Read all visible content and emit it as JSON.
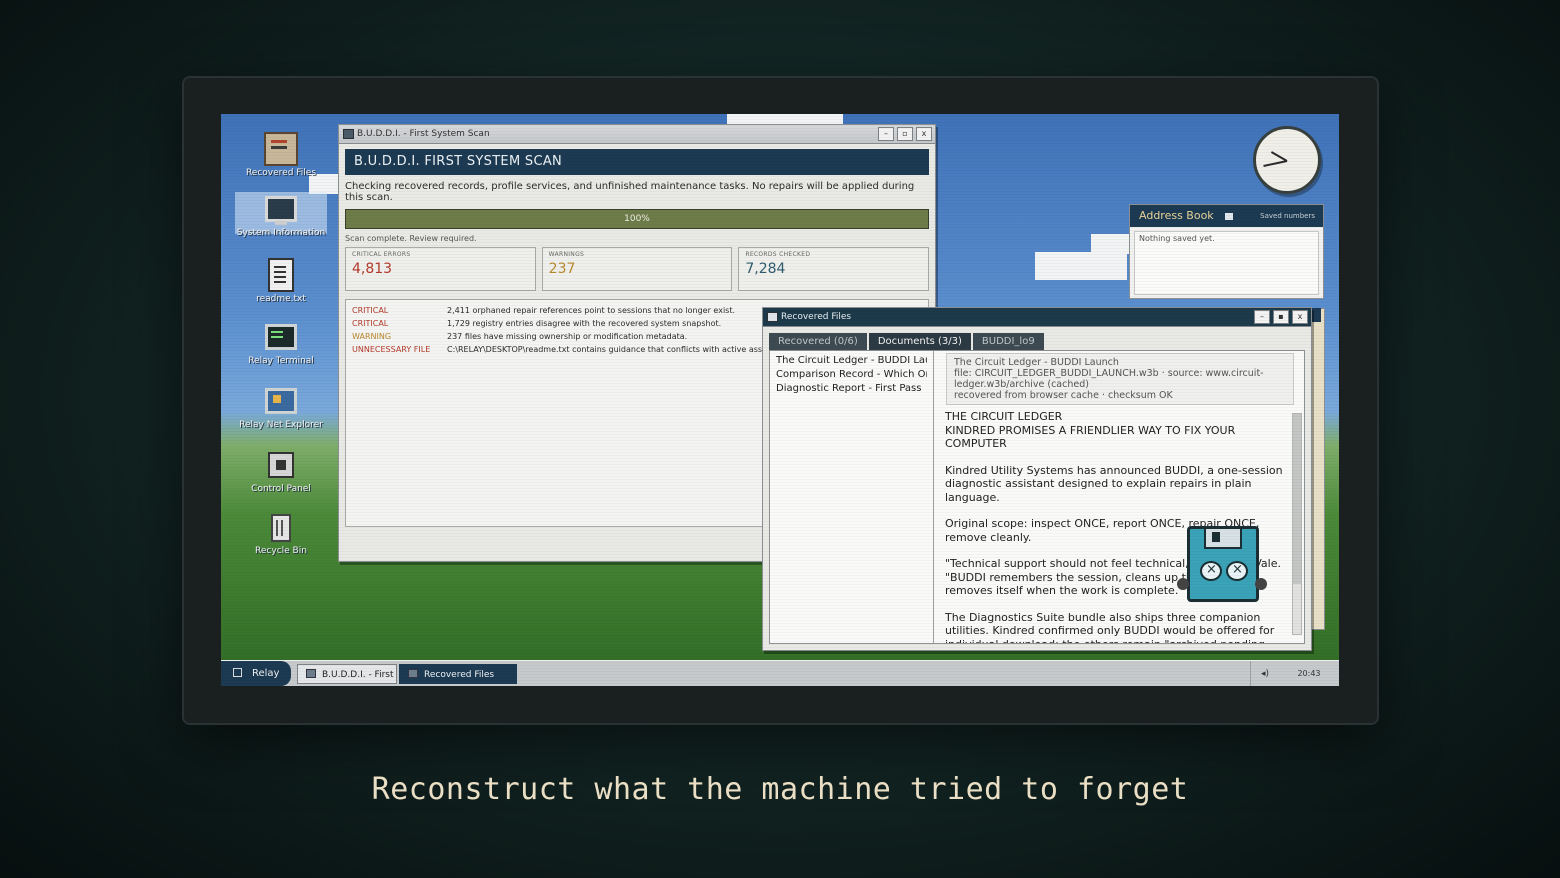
{
  "desktop_icons": [
    {
      "label": "Recovered Files",
      "icon": "recovered-files-icon"
    },
    {
      "label": "System Information",
      "icon": "system-information-icon"
    },
    {
      "label": "readme.txt",
      "icon": "readme-icon"
    },
    {
      "label": "Relay Terminal",
      "icon": "terminal-icon"
    },
    {
      "label": "Relay Net Explorer",
      "icon": "net-explorer-icon"
    },
    {
      "label": "Control Panel",
      "icon": "control-panel-icon"
    },
    {
      "label": "Recycle Bin",
      "icon": "recycle-bin-icon"
    }
  ],
  "scan_window": {
    "title": "B.U.D.D.I. - First System Scan",
    "header": "B.U.D.D.I. FIRST SYSTEM SCAN",
    "description": "Checking recovered records, profile services, and unfinished maintenance tasks. No repairs will be applied during this scan.",
    "progress": 1.0,
    "progress_label": "100%",
    "status": "Scan complete. Review required.",
    "stats": [
      {
        "label": "CRITICAL ERRORS",
        "value": "4,813",
        "color": "#b5392c"
      },
      {
        "label": "WARNINGS",
        "value": "237",
        "color": "#b98a2f"
      },
      {
        "label": "RECORDS CHECKED",
        "value": "7,284",
        "color": "#2f5b6e"
      }
    ],
    "log": [
      {
        "level": "CRITICAL",
        "message": "2,411 orphaned repair references point to sessions that no longer exist."
      },
      {
        "level": "CRITICAL",
        "message": "1,729 registry entries disagree with the recovered system snapshot."
      },
      {
        "level": "WARNING",
        "message": "237 files have missing ownership or modification metadata."
      },
      {
        "level": "UNNECESSARY FILE",
        "message": "C:\\RELAY\\DESKTOP\\readme.txt contains guidance that conflicts with active assista"
      }
    ]
  },
  "address_book": {
    "title": "Address Book",
    "saved_label": "Saved numbers",
    "empty_text": "Nothing saved yet."
  },
  "recovered_window": {
    "title": "Recovered Files",
    "tabs": [
      "Recovered (0/6)",
      "Documents (3/3)",
      "BUDDI_lo9"
    ],
    "active_tab": 1,
    "files": [
      "The Circuit Ledger - BUDDI Lau...",
      "Comparison Record - Which On...",
      "Diagnostic Report - First Pass"
    ],
    "meta": {
      "line1": "The Circuit Ledger - BUDDI Launch",
      "line2": "file: CIRCUIT_LEDGER_BUDDI_LAUNCH.w3b  ·  source: www.circuit-ledger.w3b/archive (cached)",
      "line3": "recovered from browser cache · checksum OK"
    },
    "paragraphs": [
      "THE CIRCUIT LEDGER\nKINDRED PROMISES A FRIENDLIER WAY TO FIX YOUR COMPUTER",
      "Kindred Utility Systems has announced BUDDI, a one-session diagnostic assistant designed to explain repairs in plain language.",
      "Original scope: inspect ONCE, report ONCE, repair ONCE, remove cleanly.",
      "\"Technical support should not feel technical,\" said Mara Vale. \"BUDDI remembers the session, cleans up the mess, and removes itself when the work is complete.\"",
      "The Diagnostics Suite bundle also ships three companion utilities. Kindred confirmed only BUDDI would be offered for individual download; the others remain \"archived pending interest.\""
    ]
  },
  "taskbar": {
    "start_label": "Relay",
    "tasks": [
      "B.U.D.D.I. - First Syst...",
      "Recovered Files"
    ],
    "active_task": 1,
    "time": "20:43"
  },
  "tagline": "Reconstruct what the machine tried to forget",
  "colors": {
    "accent_navy": "#1c3a52",
    "critical": "#b5392c",
    "warning": "#b98a2f",
    "info": "#2f5b6e",
    "tagline": "#eadfc5"
  }
}
